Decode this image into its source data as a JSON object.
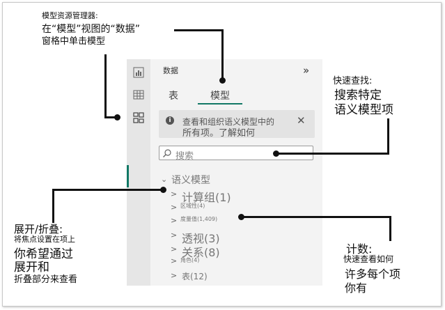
{
  "pane": {
    "title": "数据",
    "collapse_glyph": "»",
    "tabs": [
      {
        "label": "表",
        "active": false
      },
      {
        "label": "模型",
        "active": true
      }
    ],
    "info": {
      "line1": "查看和组织语义模型中的",
      "line2": "所有项。了解如何"
    },
    "search_placeholder": "搜索",
    "tree": {
      "root": "语义模型",
      "items": [
        {
          "label": "计算组(1)"
        },
        {
          "label": "区域性(4)"
        },
        {
          "label": "度量值(1,409)"
        },
        {
          "label": "透视(3)"
        },
        {
          "label": "关系(8)"
        },
        {
          "label": "角色(4)"
        },
        {
          "label": "表(12)"
        }
      ]
    }
  },
  "annotations": {
    "model_explorer": {
      "title": "模型资源管理器:",
      "line1": "在“模型”视图的“数据”",
      "line2": "窗格中单击模型"
    },
    "quick_find": {
      "title": "快速查找:",
      "line1": "搜索特定",
      "line2": "语义模型项"
    },
    "expand_collapse": {
      "title": "展开/折叠:",
      "line1": "将焦点设置在项上",
      "line2": "你希望通过",
      "line3": "展开和",
      "line4": "折叠部分来查看"
    },
    "count": {
      "title": "计数:",
      "line1": "快速查看如何",
      "line2": "许多每个项",
      "line3": "你有"
    }
  }
}
